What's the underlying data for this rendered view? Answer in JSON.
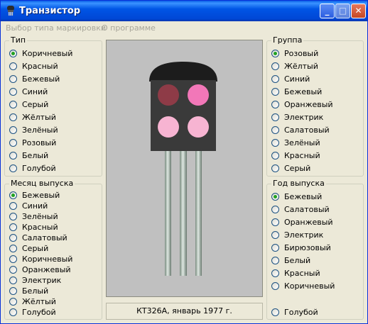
{
  "window": {
    "title": "Транзистор"
  },
  "menu": {
    "items": [
      "Выбор типа маркировки",
      "О программе"
    ]
  },
  "type_group": {
    "legend": "Тип",
    "options": [
      "Коричневый",
      "Красный",
      "Бежевый",
      "Синий",
      "Серый",
      "Жёлтый",
      "Зелёный",
      "Розовый",
      "Белый",
      "Голубой"
    ],
    "selected": 0
  },
  "month_group": {
    "legend": "Месяц выпуска",
    "options": [
      "Бежевый",
      "Синий",
      "Зелёный",
      "Красный",
      "Салатовый",
      "Серый",
      "Коричневый",
      "Оранжевый",
      "Электрик",
      "Белый",
      "Жёлтый",
      "Голубой"
    ],
    "selected": 0
  },
  "group_group": {
    "legend": "Группа",
    "options": [
      "Розовый",
      "Жёлтый",
      "Синий",
      "Бежевый",
      "Оранжевый",
      "Электрик",
      "Салатовый",
      "Зелёный",
      "Красный",
      "Серый"
    ],
    "selected": 0
  },
  "year_group": {
    "legend": "Год выпуска",
    "options": [
      "Бежевый",
      "Салатовый",
      "Оранжевый",
      "Электрик",
      "Бирюзовый",
      "Белый",
      "Красный",
      "Коричневый"
    ],
    "selected": 0,
    "extra_option": "Голубой"
  },
  "caption": "КТ326А, январь 1977 г.",
  "colors": {
    "body": "#3a3a3a",
    "cap": "#1c1c1c",
    "dot_type": "#8e3b47",
    "dot_group": "#f277b8",
    "dot_month": "#f7b4d2",
    "dot_year": "#f7b4d2"
  }
}
